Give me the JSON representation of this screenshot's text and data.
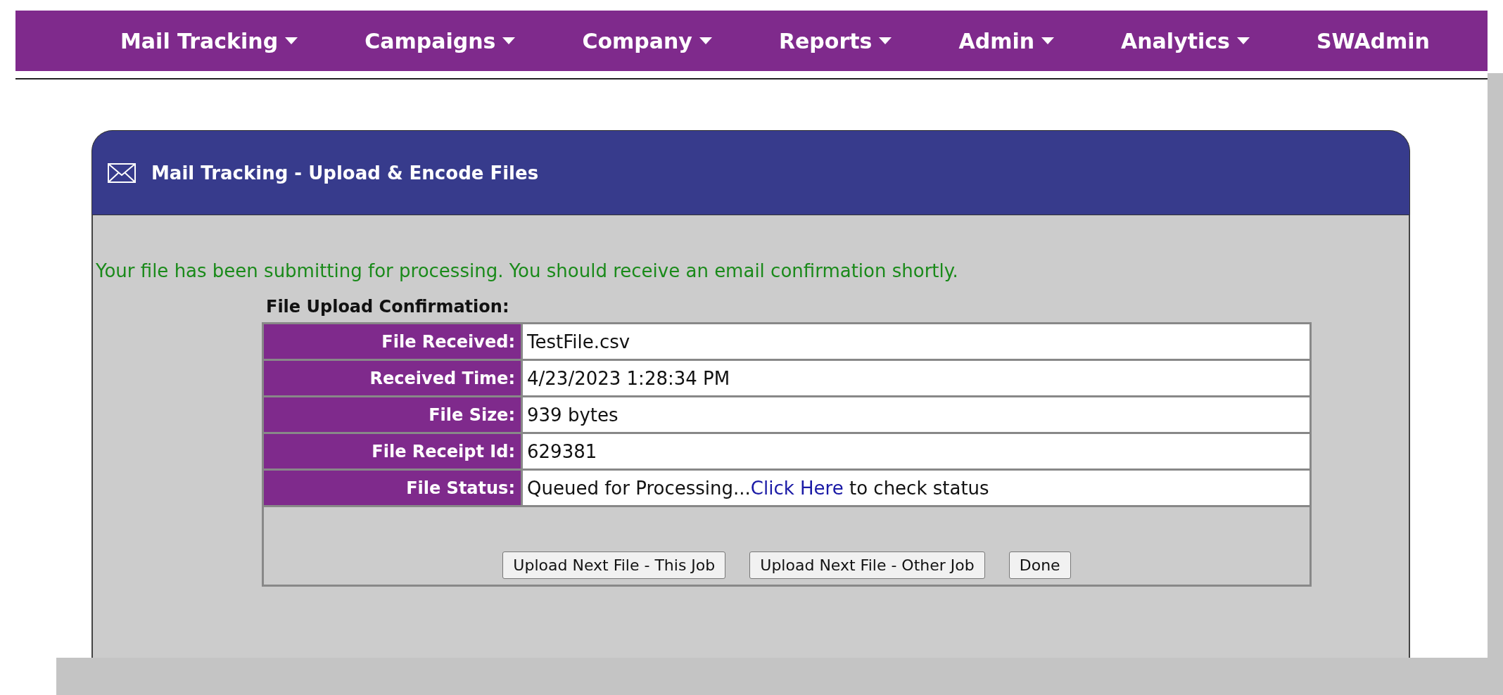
{
  "nav": [
    {
      "label": "Mail Tracking",
      "dropdown": true
    },
    {
      "label": "Campaigns",
      "dropdown": true
    },
    {
      "label": "Company",
      "dropdown": true
    },
    {
      "label": "Reports",
      "dropdown": true
    },
    {
      "label": "Admin",
      "dropdown": true
    },
    {
      "label": "Analytics",
      "dropdown": true
    },
    {
      "label": "SWAdmin",
      "dropdown": false
    }
  ],
  "panel": {
    "title": "Mail Tracking - Upload & Encode Files",
    "message": "Your file has been submitting for processing. You should receive an email confirmation shortly.",
    "confirmation": {
      "heading": "File Upload Confirmation:",
      "rows": [
        {
          "label": "File Received:",
          "value": "TestFile.csv"
        },
        {
          "label": "Received Time:",
          "value": "4/23/2023 1:28:34 PM"
        },
        {
          "label": "File Size:",
          "value": "939 bytes"
        },
        {
          "label": "File Receipt Id:",
          "value": "629381"
        },
        {
          "label": "File Status:",
          "value": "Queued for Processing...",
          "link": "Click Here",
          "suffix": " to check status"
        }
      ],
      "buttons": [
        "Upload Next File - This Job",
        "Upload Next File - Other Job",
        "Done"
      ]
    }
  }
}
